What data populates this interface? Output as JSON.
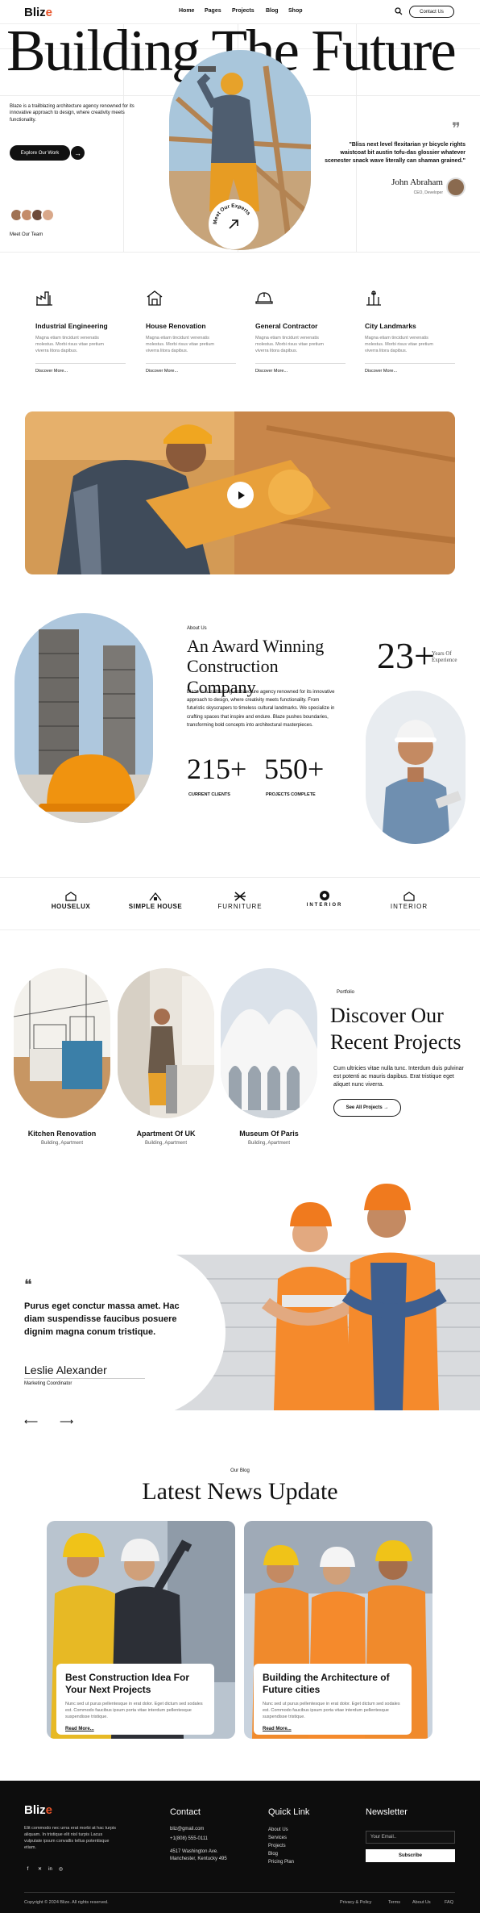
{
  "brand": {
    "logo_text": "Bliz",
    "logo_accent": "e",
    "accent_color": "#e8542a"
  },
  "nav": {
    "items": [
      "Home",
      "Pages",
      "Projects",
      "Blog",
      "Shop"
    ],
    "search_icon": "search-icon",
    "contact_label": "Contact Us"
  },
  "hero": {
    "title": "Building The Future",
    "text": "Blaze is a trailblazing architecture agency renowned for its innovative approach to design, where creativity meets functionality.",
    "cta_label": "Explore Our Work",
    "meet_label": "Meet Our Team",
    "badge_text": "Meet Our Experts",
    "quote": "\"Bliss next level flexitarian yr bicycle rights waistcoat bit austin tofu-das glossier whatever scenester snack wave literally can shaman grained.\"",
    "quote_name": "John Abraham",
    "quote_role": "CEO, Developer"
  },
  "services": [
    {
      "title": "Industrial Engineering",
      "text": "Magna etiam tincidunt venenatis molestus. Morbi risus vitae pretium viverra litora dapibus.",
      "link": "Discover More..."
    },
    {
      "title": "House Renovation",
      "text": "Magna etiam tincidunt venenatis molestus. Morbi risus vitae pretium viverra litora dapibus.",
      "link": "Discover More..."
    },
    {
      "title": "General Contractor",
      "text": "Magna etiam tincidunt venenatis molestus. Morbi risus vitae pretium viverra litora dapibus.",
      "link": "Discover More..."
    },
    {
      "title": "City Landmarks",
      "text": "Magna etiam tincidunt venenatis molestus. Morbi risus vitae pretium viverra litora dapibus.",
      "link": "Discover More..."
    }
  ],
  "about": {
    "tag": "About Us",
    "title": "An Award Winning Construction Company",
    "text": "Blaze is a trailblazing architecture agency renowned for its innovative approach to design, where creativity meets functionality. From futuristic skyscrapers to timeless cultural landmarks. We specialize in crafting spaces that inspire and endure. Blaze pushes boundaries, transforming bold concepts into architectural masterpieces.",
    "stat1_value": "215+",
    "stat1_label": "CURRENT CLIENTS",
    "stat2_value": "550+",
    "stat2_label": "PROJECTS COMPLETE",
    "years_value": "23+",
    "years_label": "Years Of Experience"
  },
  "brands": [
    "HOUSELUX",
    "SIMPLE HOUSE",
    "FURNITURE",
    "INTERIOR",
    "INTERIOR"
  ],
  "portfolio": {
    "tag": "Portfolio",
    "title": "Discover Our Recent Projects",
    "text": "Cum ultricies vitae nulla tunc. Interdum duis pulvinar est potenti ac mauris dapibus. Erat tristique eget aliquet nunc viverra.",
    "cta_label": "See All Projects",
    "projects": [
      {
        "title": "Kitchen Renovation",
        "category": "Building, Apartment"
      },
      {
        "title": "Apartment Of UK",
        "category": "Building, Apartment"
      },
      {
        "title": "Museum Of Paris",
        "category": "Building, Apartment"
      }
    ]
  },
  "testimonial": {
    "quote": "Purus eget conctur massa amet. Hac diam suspendisse faucibus posuere dignim magna conum tristique.",
    "name": "Leslie Alexander",
    "role": "Marketing Coordinator",
    "prev_icon": "arrow-left-icon",
    "next_icon": "arrow-right-icon"
  },
  "blog": {
    "tag": "Our Blog",
    "title": "Latest News Update",
    "posts": [
      {
        "title": "Best Construction Idea For Your Next Projects",
        "text": "Nunc sed ut purus pellentesque in erat dolor. Eget dictum sed sodales est. Commodo faucibus ipsum porta vitae interdum pellentesque suspendisse tristique.",
        "link": "Read More..."
      },
      {
        "title": "Building the Architecture of Future cities",
        "text": "Nunc sed ut purus pellentesque in erat dolor. Eget dictum sed sodales est. Commodo faucibus ipsum porta vitae interdum pellentesque suspendisse tristique.",
        "link": "Read More..."
      }
    ]
  },
  "footer": {
    "desc": "Elit commodo nec urna erat morbi at hac turpis aliquam. In tristique elit nisl turpis Lacus vulputate ipsum convallis tellus potentisque etiam.",
    "contact_heading": "Contact",
    "contact": [
      "bliz@gmail.com",
      "+1(808) 555-0111",
      "4517 Washington Ave.",
      "Manchester, Kentucky 495"
    ],
    "links_heading": "Quick Link",
    "links": [
      "About Us",
      "Services",
      "Projects",
      "Blog",
      "Pricing Plan"
    ],
    "news_heading": "Newsletter",
    "email_placeholder": "Your Email..",
    "subscribe_label": "Subscribe",
    "copyright": "Copyright © 2024 Blize. All rights reserved.",
    "bottom_links": [
      "Privacy & Policy",
      "Terms",
      "About Us",
      "FAQ"
    ]
  }
}
